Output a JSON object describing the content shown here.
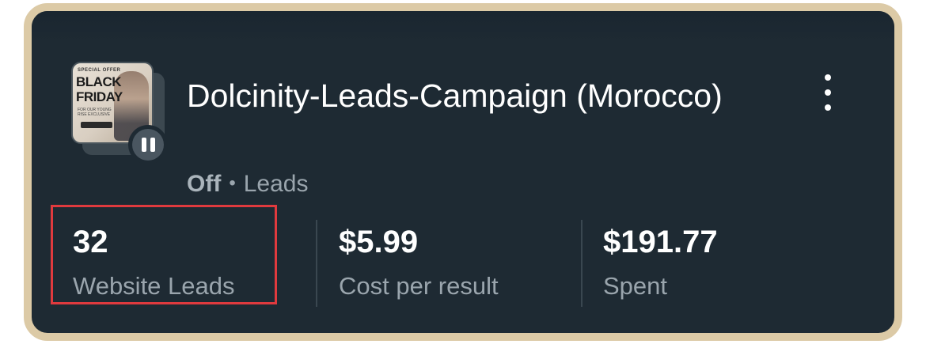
{
  "campaign": {
    "title": "Dolcinity-Leads-Campaign (Morocco)",
    "status": "Off",
    "separator": "•",
    "objective": "Leads",
    "thumbnail": {
      "badge_text": "SPECIAL OFFER",
      "line1": "BLACK",
      "line2": "FRIDAY",
      "subtext": "FOR OUR YOUNG RISE EXCLUSIVE"
    },
    "state_icon": "pause-icon",
    "menu_icon": "more-vertical-icon"
  },
  "metrics": [
    {
      "value": "32",
      "label": "Website Leads"
    },
    {
      "value": "$5.99",
      "label": "Cost per result"
    },
    {
      "value": "$191.77",
      "label": "Spent"
    }
  ],
  "colors": {
    "card_background": "#1e2a33",
    "frame_border": "#dccaa6",
    "highlight_border": "#e03a3e",
    "muted_text": "#9aa5ad"
  }
}
